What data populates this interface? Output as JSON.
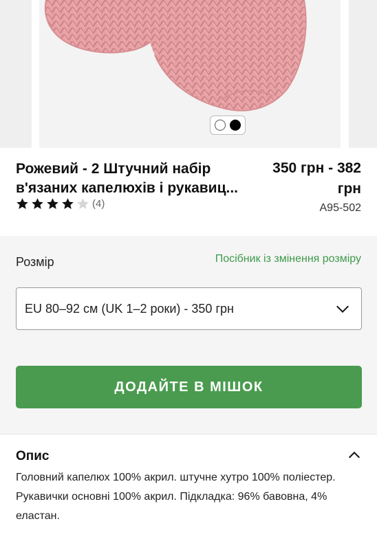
{
  "product": {
    "title": "Рожевий - 2 Штучний набір в'язаних капелюхів і рукавиц...",
    "price": "350 грн - 382 грн",
    "rating": 4,
    "rating_max": 5,
    "review_count": "(4)",
    "sku": "A95-502"
  },
  "carousel": {
    "image_alt": "pink-knitted-mitten",
    "slides": 2,
    "active_slide": 2
  },
  "size": {
    "label": "Розмір",
    "guide_link": "Посібник із змінення розміру",
    "selected": "EU 80–92 см (UK 1–2 роки) - 350 грн"
  },
  "cart": {
    "add_label": "ДОДАЙТЕ В МІШОК"
  },
  "description": {
    "title": "Опис",
    "text": "Головний капелюх 100% акрил. штучне хутро 100% поліестер. Рукавички основні 100% акрил. Підкладка: 96% бавовна, 4% еластан."
  },
  "colors": {
    "accent": "#4a9b4f",
    "link": "#3f9a4c",
    "knit": "#e9a3a6"
  }
}
